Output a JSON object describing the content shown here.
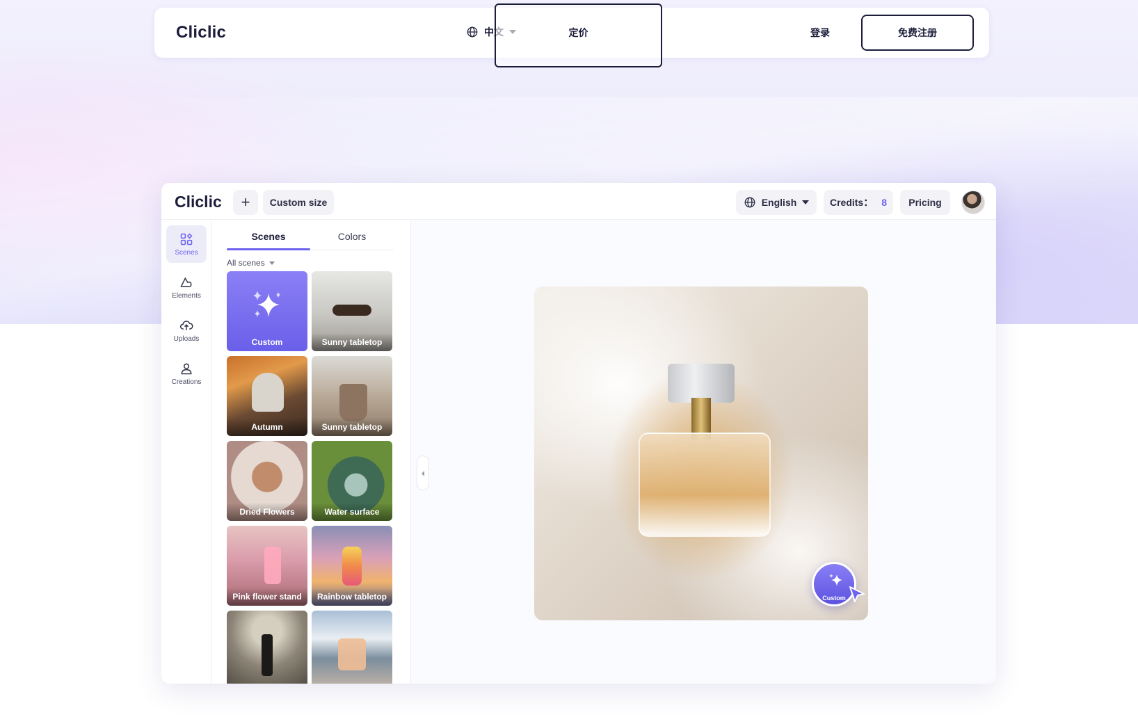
{
  "topnav": {
    "logo": "Cliclic",
    "language": "中文",
    "pricing": "定价",
    "login": "登录",
    "signup": "免费注册"
  },
  "app": {
    "logo": "Cliclic",
    "add_label": "+",
    "custom_size": "Custom size",
    "language": "English",
    "credits_label": "Credits：",
    "credits_value": "8",
    "pricing": "Pricing"
  },
  "rail": {
    "items": [
      {
        "label": "Scenes",
        "icon": "grid-icon",
        "active": true
      },
      {
        "label": "Elements",
        "icon": "shapes-icon",
        "active": false
      },
      {
        "label": "Uploads",
        "icon": "cloud-upload-icon",
        "active": false
      },
      {
        "label": "Creations",
        "icon": "user-icon",
        "active": false
      }
    ]
  },
  "panel": {
    "tabs": [
      "Scenes",
      "Colors"
    ],
    "active_tab": "Scenes",
    "filter": "All scenes",
    "scenes": [
      "Custom",
      "Sunny tabletop",
      "Autumn",
      "Sunny tabletop",
      "Dried Flowers",
      "Water surface",
      "Pink flower stand",
      "Rainbow tabletop",
      "",
      ""
    ]
  },
  "canvas": {
    "badge_label": "Custom"
  },
  "colors": {
    "accent": "#6d62f0",
    "dark": "#1b1d3a"
  }
}
